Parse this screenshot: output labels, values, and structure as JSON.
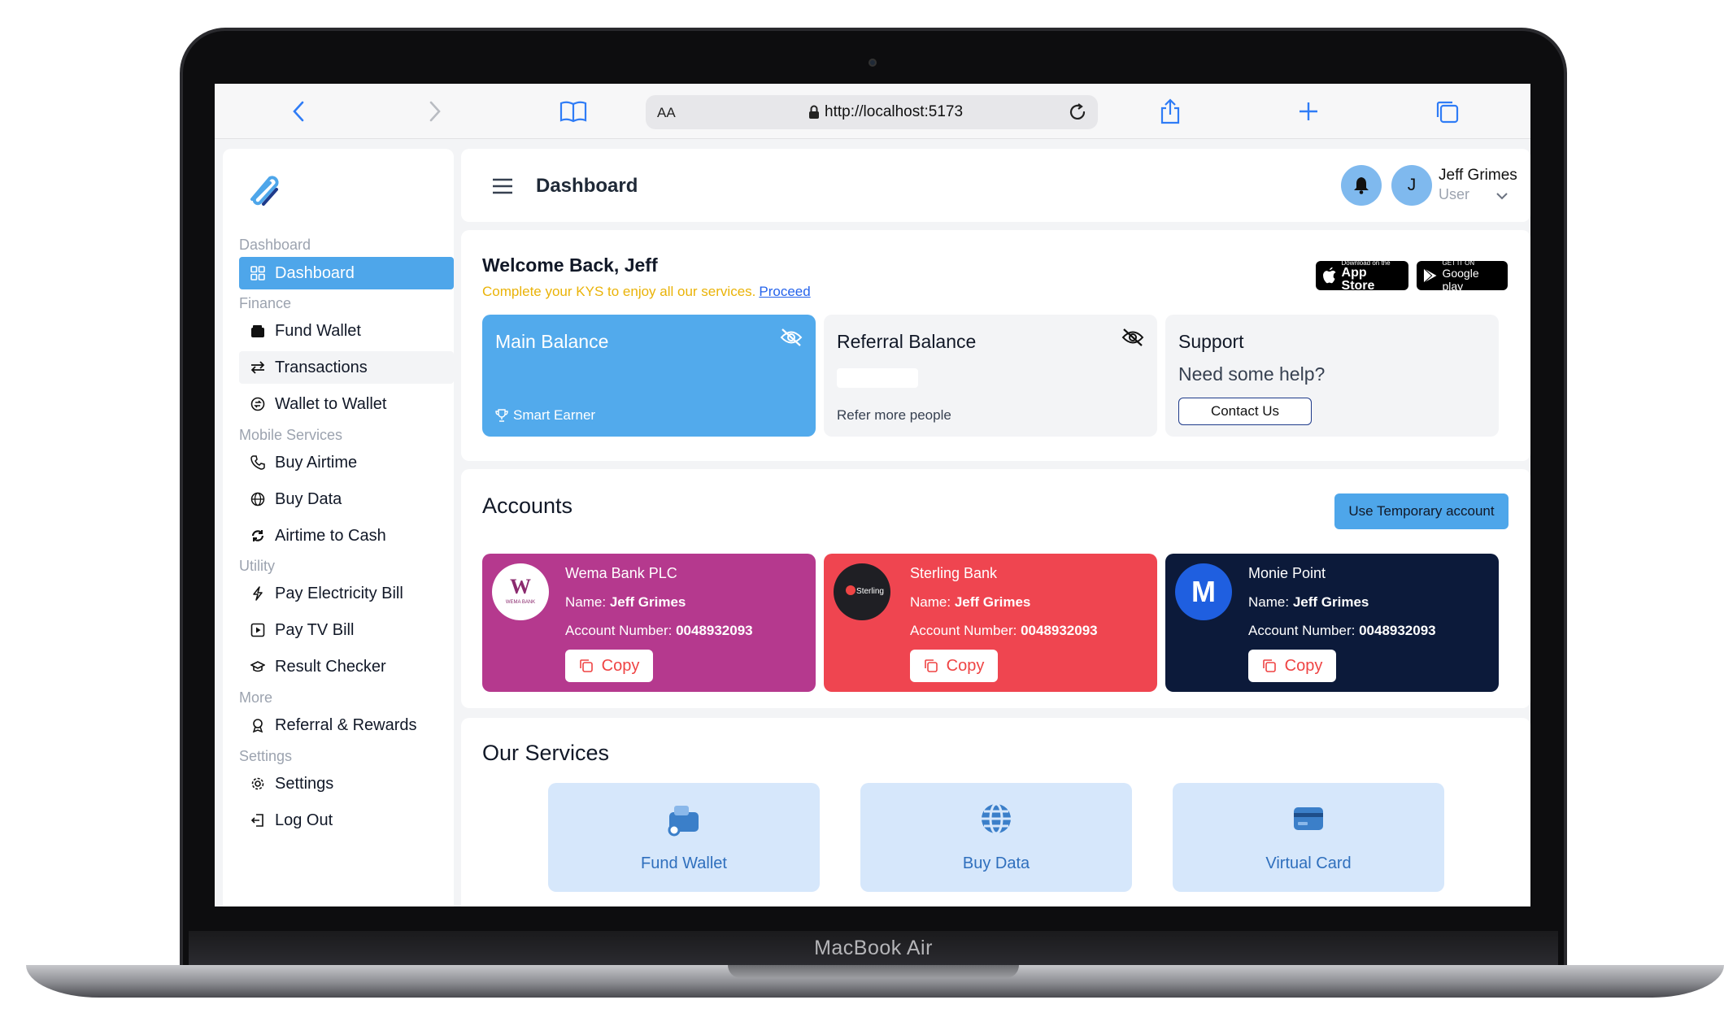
{
  "device": {
    "label": "MacBook Air"
  },
  "browser": {
    "text_size_label": "AA",
    "url": "http://localhost:5173"
  },
  "sidebar": {
    "sections": {
      "dashboard": "Dashboard",
      "finance": "Finance",
      "mobile": "Mobile Services",
      "utility": "Utility",
      "more": "More",
      "settings": "Settings"
    },
    "items": {
      "dashboard": "Dashboard",
      "fund_wallet": "Fund Wallet",
      "transactions": "Transactions",
      "wallet_to_wallet": "Wallet to Wallet",
      "buy_airtime": "Buy Airtime",
      "buy_data": "Buy Data",
      "airtime_to_cash": "Airtime to Cash",
      "electricity": "Pay Electricity Bill",
      "tv": "Pay TV Bill",
      "result_checker": "Result Checker",
      "referral": "Referral & Rewards",
      "settings": "Settings",
      "logout": "Log Out"
    }
  },
  "header": {
    "title": "Dashboard",
    "avatar_initial": "J",
    "user_name": "Jeff Grimes",
    "user_role": "User"
  },
  "welcome": {
    "title": "Welcome Back, Jeff",
    "kyc_text": "Complete your KYS to enjoy all our services.",
    "kyc_link": "Proceed",
    "app_store": {
      "small": "Download on the",
      "big": "App Store"
    },
    "google_play": {
      "small": "GET IT ON",
      "big": "Google play"
    }
  },
  "balances": {
    "main": {
      "title": "Main Balance",
      "subtitle": "Smart Earner"
    },
    "referral": {
      "title": "Referral Balance",
      "subtitle": "Refer more people"
    },
    "support": {
      "title": "Support",
      "subtitle": "Need some help?",
      "button": "Contact Us"
    }
  },
  "accounts": {
    "title": "Accounts",
    "temp_button": "Use Temporary account",
    "name_label": "Name:",
    "number_label": "Account Number:",
    "copy_label": "Copy",
    "items": [
      {
        "bank": "Wema Bank PLC",
        "name": "Jeff Grimes",
        "number": "0048932093",
        "logo_text": "WEMA BANK",
        "color": "#b5398e"
      },
      {
        "bank": "Sterling Bank",
        "name": "Jeff Grimes",
        "number": "0048932093",
        "logo_text": "Sterling",
        "color": "#ef4550"
      },
      {
        "bank": "Monie Point",
        "name": "Jeff Grimes",
        "number": "0048932093",
        "logo_text": "M",
        "color": "#0c1a3a"
      }
    ]
  },
  "services": {
    "title": "Our Services",
    "items": [
      {
        "label": "Fund Wallet",
        "icon": "wallet-icon"
      },
      {
        "label": "Buy Data",
        "icon": "globe-icon"
      },
      {
        "label": "Virtual Card",
        "icon": "card-icon"
      }
    ]
  },
  "colors": {
    "accent": "#4ea6ea",
    "kyc_warning": "#eab308",
    "copy_text": "#ef4444"
  }
}
